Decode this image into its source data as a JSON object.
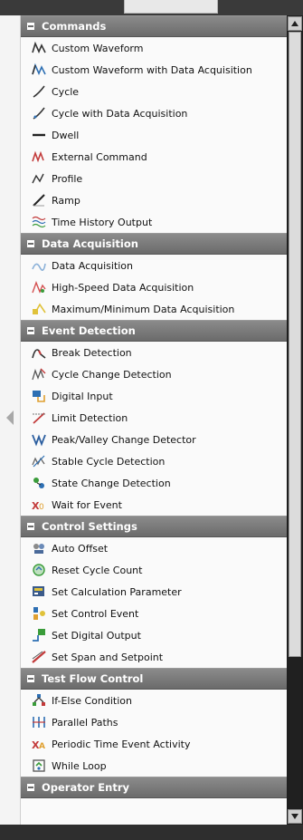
{
  "sections": [
    {
      "title": "Commands",
      "items": [
        {
          "label": "Custom Waveform",
          "icon": "custom-waveform-icon"
        },
        {
          "label": "Custom Waveform with Data Acquisition",
          "icon": "custom-waveform-daq-icon"
        },
        {
          "label": "Cycle",
          "icon": "cycle-icon"
        },
        {
          "label": "Cycle with Data Acquisition",
          "icon": "cycle-daq-icon"
        },
        {
          "label": "Dwell",
          "icon": "dwell-icon"
        },
        {
          "label": "External Command",
          "icon": "external-command-icon"
        },
        {
          "label": "Profile",
          "icon": "profile-icon"
        },
        {
          "label": "Ramp",
          "icon": "ramp-icon"
        },
        {
          "label": "Time History Output",
          "icon": "time-history-icon"
        }
      ]
    },
    {
      "title": "Data Acquisition",
      "items": [
        {
          "label": "Data Acquisition",
          "icon": "data-acquisition-icon"
        },
        {
          "label": "High-Speed Data Acquisition",
          "icon": "high-speed-daq-icon"
        },
        {
          "label": "Maximum/Minimum Data Acquisition",
          "icon": "max-min-daq-icon"
        }
      ]
    },
    {
      "title": "Event Detection",
      "items": [
        {
          "label": "Break Detection",
          "icon": "break-detection-icon"
        },
        {
          "label": "Cycle Change Detection",
          "icon": "cycle-change-icon"
        },
        {
          "label": "Digital Input",
          "icon": "digital-input-icon"
        },
        {
          "label": "Limit Detection",
          "icon": "limit-detection-icon"
        },
        {
          "label": "Peak/Valley Change Detector",
          "icon": "peak-valley-icon"
        },
        {
          "label": "Stable Cycle Detection",
          "icon": "stable-cycle-icon"
        },
        {
          "label": "State Change Detection",
          "icon": "state-change-icon"
        },
        {
          "label": "Wait for Event",
          "icon": "wait-event-icon"
        }
      ]
    },
    {
      "title": "Control Settings",
      "items": [
        {
          "label": "Auto Offset",
          "icon": "auto-offset-icon"
        },
        {
          "label": "Reset Cycle Count",
          "icon": "reset-cycle-icon"
        },
        {
          "label": "Set Calculation Parameter",
          "icon": "calc-parameter-icon"
        },
        {
          "label": "Set Control Event",
          "icon": "control-event-icon"
        },
        {
          "label": "Set Digital Output",
          "icon": "digital-output-icon"
        },
        {
          "label": "Set Span and Setpoint",
          "icon": "span-setpoint-icon"
        }
      ]
    },
    {
      "title": "Test Flow Control",
      "items": [
        {
          "label": "If-Else Condition",
          "icon": "if-else-icon"
        },
        {
          "label": "Parallel Paths",
          "icon": "parallel-paths-icon"
        },
        {
          "label": "Periodic Time Event Activity",
          "icon": "periodic-time-icon"
        },
        {
          "label": "While Loop",
          "icon": "while-loop-icon"
        }
      ]
    },
    {
      "title": "Operator Entry",
      "items": []
    }
  ]
}
